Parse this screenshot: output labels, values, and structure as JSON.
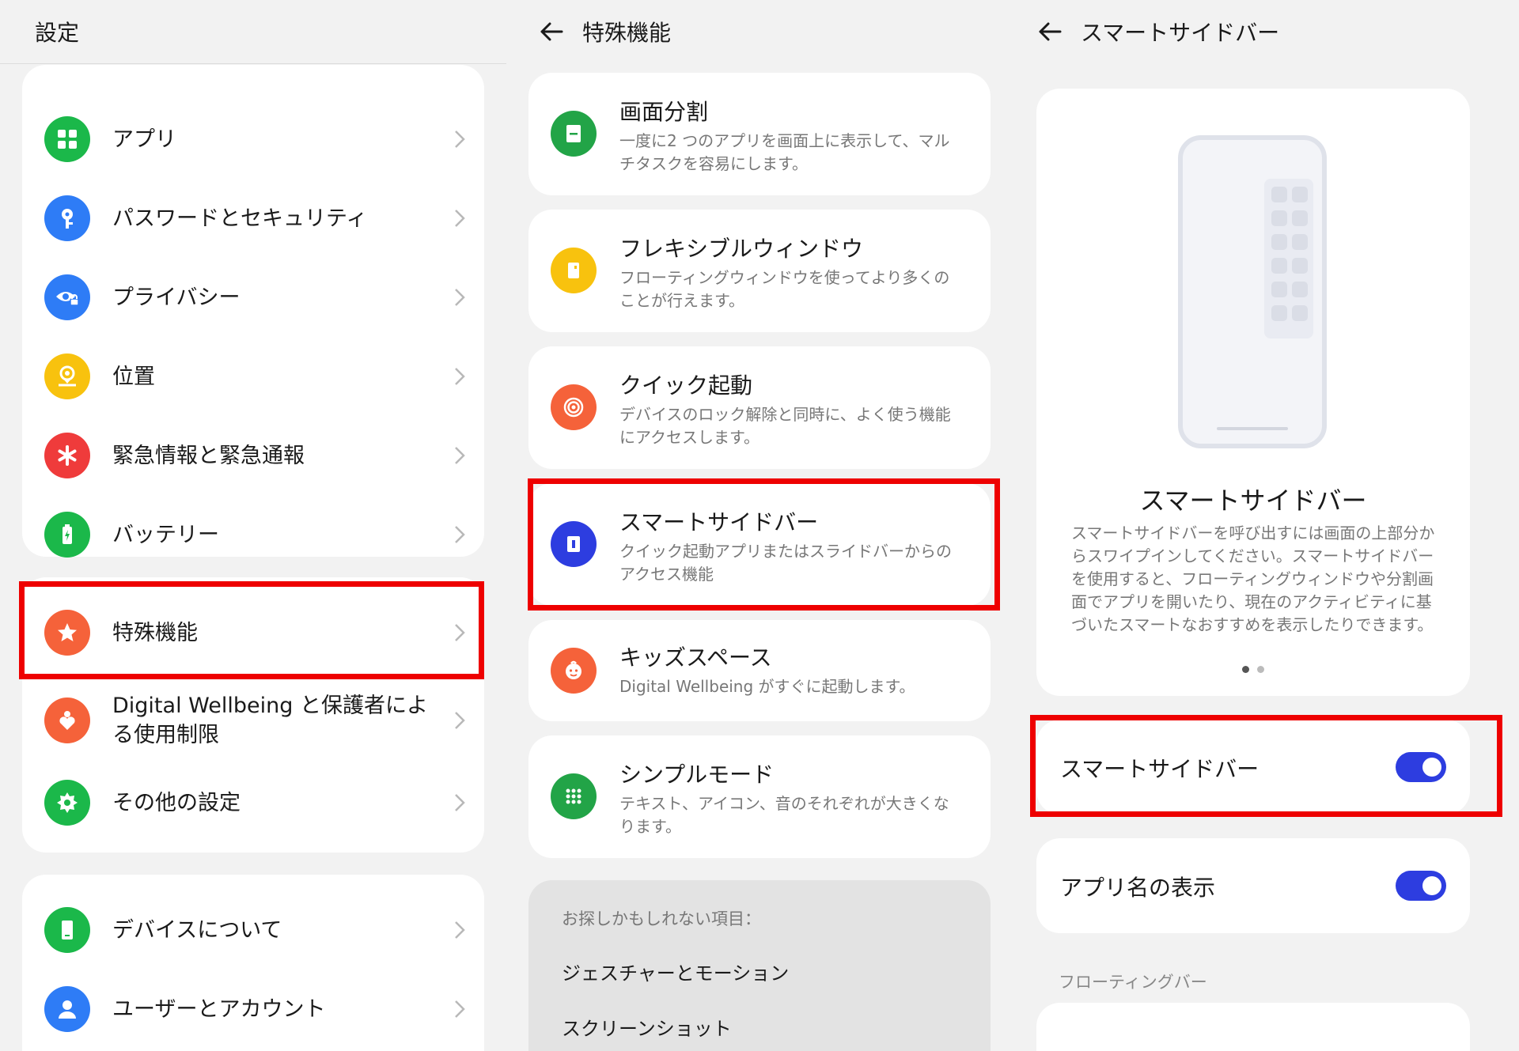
{
  "panel1": {
    "title": "設定",
    "group1": [
      {
        "label": "アプリ",
        "icon": "apps-grid-icon",
        "color": "#1bb84a"
      },
      {
        "label": "パスワードとセキュリティ",
        "icon": "key-icon",
        "color": "#2e7cf6"
      },
      {
        "label": "プライバシー",
        "icon": "eye-lock-icon",
        "color": "#2e7cf6"
      },
      {
        "label": "位置",
        "icon": "location-pin-icon",
        "color": "#f8c20e"
      },
      {
        "label": "緊急情報と緊急通報",
        "icon": "asterisk-icon",
        "color": "#ef3b3b"
      },
      {
        "label": "バッテリー",
        "icon": "battery-icon",
        "color": "#1bb84a"
      }
    ],
    "group2": [
      {
        "label": "特殊機能",
        "icon": "star-icon",
        "color": "#f5623a"
      },
      {
        "label": "Digital Wellbeing と保護者による使用制限",
        "icon": "heart-person-icon",
        "color": "#f5623a"
      },
      {
        "label": "その他の設定",
        "icon": "gear-icon",
        "color": "#1bb84a"
      }
    ],
    "group3": [
      {
        "label": "デバイスについて",
        "icon": "phone-icon",
        "color": "#1bb84a"
      },
      {
        "label": "ユーザーとアカウント",
        "icon": "user-icon",
        "color": "#2e7cf6"
      }
    ]
  },
  "panel2": {
    "title": "特殊機能",
    "features": [
      {
        "title": "画面分割",
        "desc": "一度に2 つのアプリを画面上に表示して、マルチタスクを容易にします。",
        "icon": "split-screen-icon",
        "color": "#22a447"
      },
      {
        "title": "フレキシブルウィンドウ",
        "desc": "フローティングウィンドウを使ってより多くのことが行えます。",
        "icon": "flexible-window-icon",
        "color": "#f8c20e"
      },
      {
        "title": "クイック起動",
        "desc": "デバイスのロック解除と同時に、よく使う機能にアクセスします。",
        "icon": "fingerprint-target-icon",
        "color": "#f5623a"
      },
      {
        "title": "スマートサイドバー",
        "desc": "クイック起動アプリまたはスライドバーからのアクセス機能",
        "icon": "sidebar-icon",
        "color": "#2d3de0"
      },
      {
        "title": "キッズスペース",
        "desc": "Digital Wellbeing がすぐに起動します。",
        "icon": "kid-face-icon",
        "color": "#f5623a"
      },
      {
        "title": "シンプルモード",
        "desc": "テキスト、アイコン、音のそれぞれが大きくなります。",
        "icon": "dots-grid-icon",
        "color": "#22a447"
      }
    ],
    "suggest_label": "お探しかもしれない項目：",
    "suggestions": [
      "ジェスチャーとモーション",
      "スクリーンショット"
    ]
  },
  "panel3": {
    "title": "スマートサイドバー",
    "hero_title": "スマートサイドバー",
    "hero_desc": "スマートサイドバーを呼び出すには画面の上部分からスワイプインしてください。スマートサイドバーを使用すると、フローティングウィンドウや分割画面でアプリを開いたり、現在のアクティビティに基づいたスマートなおすすめを表示したりできます。",
    "toggle1_label": "スマートサイドバー",
    "toggle1_on": true,
    "toggle2_label": "アプリ名の表示",
    "toggle2_on": true,
    "section_label": "フローティングバー",
    "accent": "#2d3de0"
  },
  "highlight_color": "#ee0000"
}
